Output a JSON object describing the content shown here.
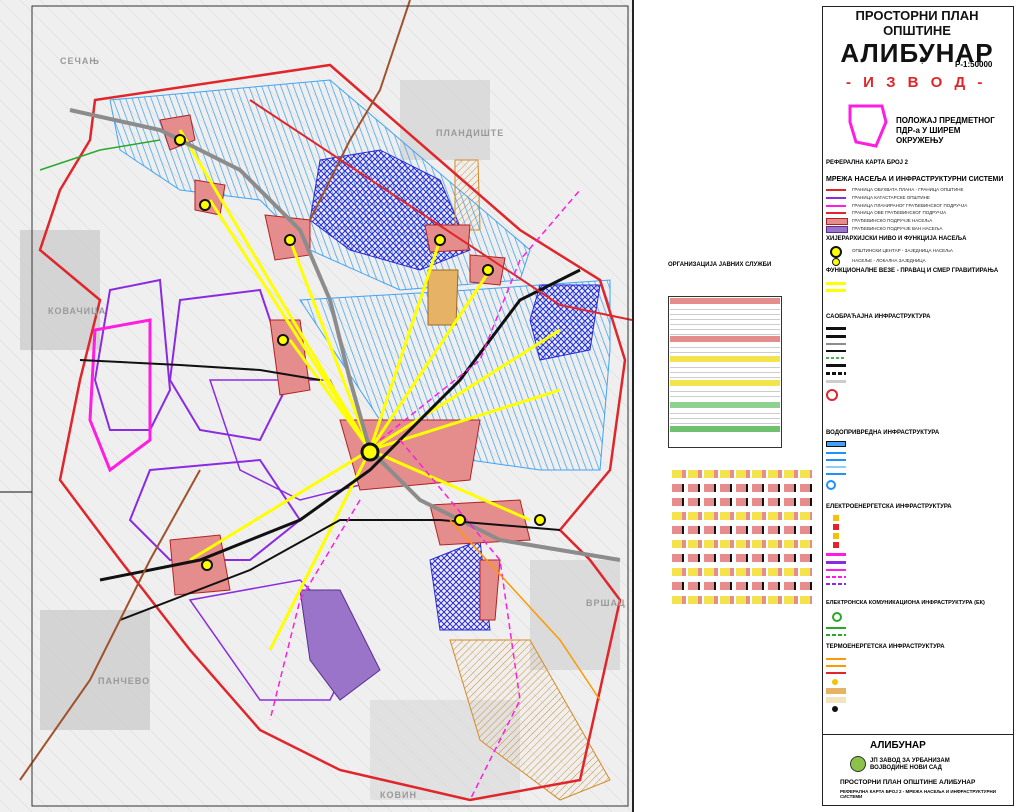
{
  "title_block": {
    "heading": "ПРОСТОРНИ ПЛАН ОПШТИНЕ",
    "municipality": "АЛИБУНАР",
    "scale": "Р-1:50000",
    "extract": "- И З В О Д -",
    "location_label": "ПОЛОЖАЈ ПРЕДМЕТНОГ ПДР-а У ШИРЕМ ОКРУЖЕЊУ",
    "ref_map": "РЕФЕРАЛНА КАРТА БРОЈ 2",
    "map_title": "МРЕЖА НАСЕЉА И ИНФРАСТРУКТУРНИ СИСТЕМИ"
  },
  "legend_sections": {
    "hierarchy": "ХИЈЕРАРХИЈСКИ НИВО И ФУНКЦИЈА НАСЕЉА",
    "functional": "ФУНКЦИОНАЛНЕ ВЕЗЕ - ПРАВАЦ И СМЕР ГРАВИТИРАЊА",
    "traffic": "САОБРАЋАЈНА ИНФРАСТРУКТУРА",
    "water": "ВОДОПРИВРЕДНА ИНФРАСТРУКТУРА",
    "power": "ЕЛЕКТРОЕНЕРГЕТСКА ИНФРАСТРУКТУРА",
    "telecom": "ЕЛЕКТРОНСКА КОМУНИКАЦИОНА ИНФРАСТРУКТУРА (ЕК)",
    "thermal": "ТЕРМОЕНЕРГЕТСКА ИНФРАСТРУКТУРА",
    "public_services": "ОРГАНИЗАЦИЈА ЈАВНИХ СЛУЖБИ"
  },
  "legend_items": {
    "boundaries": [
      "ГРАНИЦА ОБУХВАТА ПЛАНА - ГРАНИЦА ОПШТИНЕ",
      "ГРАНИЦА КАТАСТАРСКЕ ОПШТИНЕ",
      "ГРАНИЦА ПЛАНИРАНОГ ГРАЂЕВИНСКОГ ПОДРУЧЈА",
      "ГРАНИЦА ОВЕ ГРАЂЕВИНСКОГ ПОДРУЧЈА",
      "ГРАЂЕВИНСКО ПОДРУЧЈЕ НАСЕЉА",
      "ГРАЂЕВИНСКО ПОДРУЧЈЕ ВАН НАСЕЉА"
    ],
    "centers": [
      "ОПШТИНСКИ ЦЕНТАР - ЗАЈЕДНИЦА НАСЕЉА",
      "НАСЕЉЕ - ЛОКАЛНА ЗАЈЕДНИЦА"
    ]
  },
  "place_names": {
    "secanj": "СЕЧАЊ",
    "plandiste": "ПЛАНДИШТЕ",
    "kovacica": "КОВАЧИЦА",
    "vrsac": "ВРШАЦ",
    "pancevo": "ПАНЧЕВО",
    "kovin": "КОВИН"
  },
  "footer": {
    "client": "АЛИБУНАР",
    "institute": "ЈП ЗАВОД ЗА УРБАНИЗАМ ВОЈВОДИНЕ НОВИ САД",
    "plan": "ПРОСТОРНИ ПЛАН ОПШТИНЕ АЛИБУНАР",
    "map": "РЕФЕРАЛНА КАРТА БРОЈ 2 - МРЕЖА НАСЕЉА И ИНФРАСТРУКТУРНИ СИСТЕМИ"
  },
  "colors": {
    "boundary": "#e0262a",
    "cadastral": "#8a2be2",
    "water": "#1e90ff",
    "gravity": "#ffff00",
    "settlement": "#e58d8d",
    "industry": "#3f3fd6",
    "gas": "#ff9900",
    "road": "#222222",
    "canal_hatch": "#59b0ff"
  }
}
